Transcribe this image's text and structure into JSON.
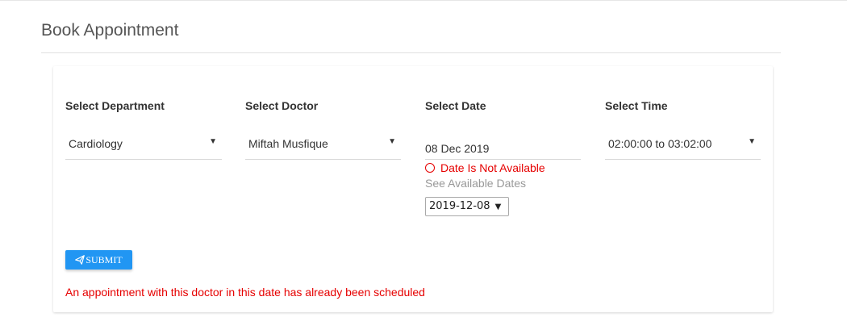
{
  "page": {
    "title": "Book Appointment"
  },
  "form": {
    "department": {
      "label": "Select Department",
      "value": "Cardiology"
    },
    "doctor": {
      "label": "Select Doctor",
      "value": "Miftah Musfique"
    },
    "date": {
      "label": "Select Date",
      "value": "08 Dec 2019",
      "error": "Date Is Not Available",
      "hint": "See Available Dates",
      "available_selected": "2019-12-08"
    },
    "time": {
      "label": "Select Time",
      "value": "02:00:00 to 03:02:00"
    },
    "submit_label": "SUBMIT",
    "alert": "An appointment with this doctor in this date has already been scheduled"
  },
  "colors": {
    "primary": "#2196f3",
    "error": "#e60000",
    "hint": "#999999"
  },
  "icons": {
    "submit": "paper-plane-icon",
    "error": "circle-icon",
    "dropdown": "caret-down-icon"
  }
}
